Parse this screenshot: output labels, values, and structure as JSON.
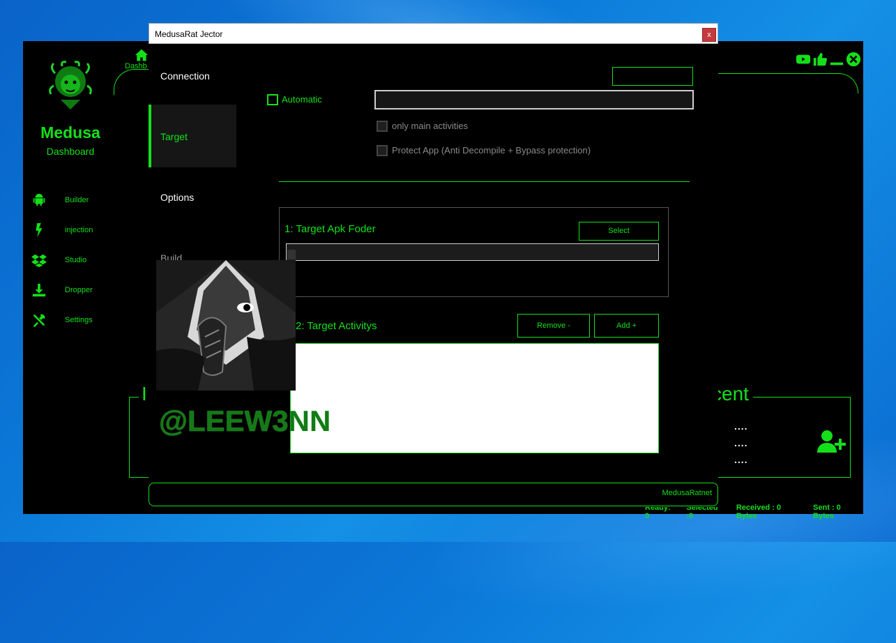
{
  "colors": {
    "accent": "#14e01a",
    "background": "#000000",
    "desktop": "#0b78d8"
  },
  "app": {
    "name": "Medusa",
    "subtitle": "Dashboard",
    "home_label": "Dashb",
    "nav": [
      {
        "label": "Builder",
        "icon": "android-icon"
      },
      {
        "label": "injection",
        "icon": "bolt-icon"
      },
      {
        "label": "Studio",
        "icon": "dropbox-icon"
      },
      {
        "label": "Dropper",
        "icon": "download-icon"
      },
      {
        "label": "Settings",
        "icon": "tools-icon"
      }
    ],
    "panel_left_text": "I",
    "panel_right_text": "cent",
    "dots": [
      "....",
      "....",
      "...."
    ],
    "status": {
      "ready": "Ready: 0",
      "selected": "Selected :0",
      "received": "Received : 0 Bytes",
      "sent": "Sent : 0 Bytes"
    }
  },
  "dialog": {
    "title": "MedusaRat Jector",
    "close_label": "x",
    "tabs": [
      "Connection",
      "Target",
      "Options",
      "Build"
    ],
    "automatic_label": "Automatic",
    "only_main_label": "only main activities",
    "protect_label": "Protect App (Anti Decompile + Bypass protection)",
    "section1_title": "1: Target Apk Foder",
    "select_label": "Select",
    "section2_title": "2: Target Activitys",
    "remove_label": "Remove -",
    "add_label": "Add +",
    "footer_text": "MedusaRatnet"
  },
  "watermark": {
    "text": "@LEEW3NN"
  }
}
